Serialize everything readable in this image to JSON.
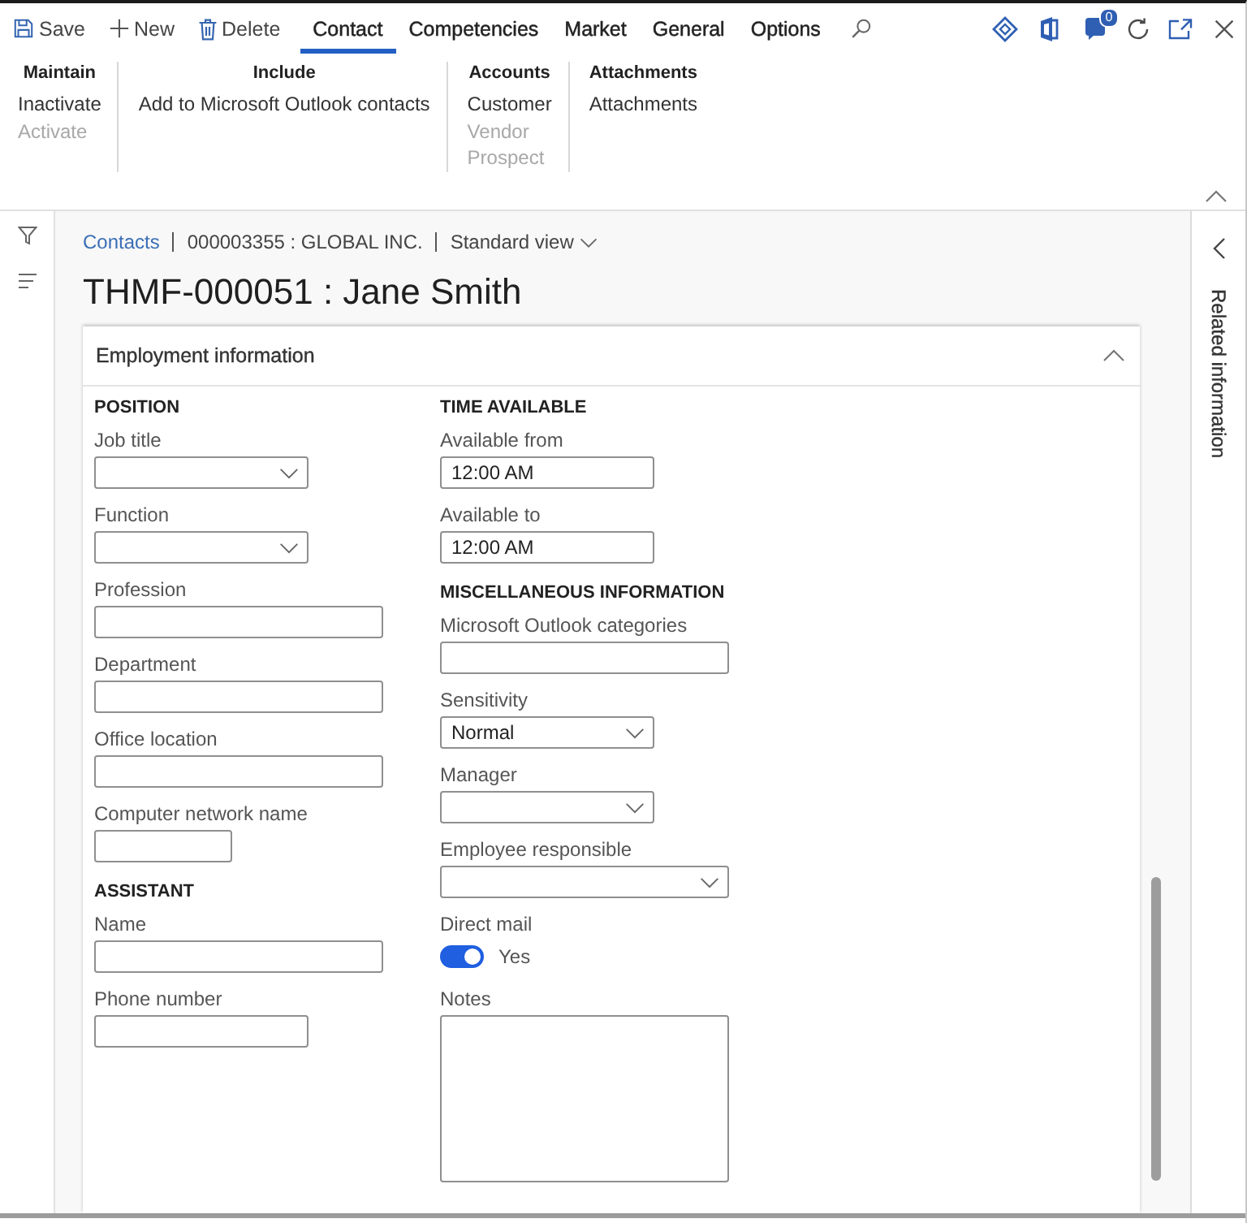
{
  "command_bar": {
    "save": {
      "label": "Save"
    },
    "new": {
      "label": "New"
    },
    "delete": {
      "label": "Delete"
    },
    "tabs": [
      {
        "label": "Contact",
        "selected": true
      },
      {
        "label": "Competencies",
        "selected": false
      },
      {
        "label": "Market",
        "selected": false
      },
      {
        "label": "General",
        "selected": false
      },
      {
        "label": "Options",
        "selected": false
      }
    ],
    "notification_count": "0"
  },
  "ribbon": {
    "groups": [
      {
        "title": "Maintain",
        "items": [
          {
            "label": "Inactivate",
            "disabled": false
          },
          {
            "label": "Activate",
            "disabled": true
          }
        ]
      },
      {
        "title": "Include",
        "items": [
          {
            "label": "Add to Microsoft Outlook contacts",
            "disabled": false
          }
        ]
      },
      {
        "title": "Accounts",
        "items": [
          {
            "label": "Customer",
            "disabled": false
          },
          {
            "label": "Vendor",
            "disabled": true
          },
          {
            "label": "Prospect",
            "disabled": true
          }
        ]
      },
      {
        "title": "Attachments",
        "items": [
          {
            "label": "Attachments",
            "disabled": false
          }
        ]
      }
    ]
  },
  "breadcrumb": {
    "link": "Contacts",
    "record": "000003355 : GLOBAL INC.",
    "view": "Standard view"
  },
  "title": "THMF-000051 : Jane Smith",
  "section": {
    "title": "Employment information",
    "expanded": true,
    "columns": [
      {
        "groups": [
          {
            "title": "POSITION",
            "fields": [
              {
                "label": "Job title",
                "kind": "dropdown"
              },
              {
                "label": "Function",
                "kind": "dropdown"
              },
              {
                "label": "Profession",
                "kind": "text"
              },
              {
                "label": "Department",
                "kind": "text"
              },
              {
                "label": "Office location",
                "kind": "text"
              },
              {
                "label": "Computer network name",
                "kind": "text"
              }
            ]
          },
          {
            "title": "ASSISTANT",
            "fields": [
              {
                "label": "Name",
                "kind": "text"
              },
              {
                "label": "Phone number",
                "kind": "text"
              }
            ]
          }
        ]
      },
      {
        "groups": [
          {
            "title": "TIME AVAILABLE",
            "fields": [
              {
                "label": "Available from",
                "kind": "text",
                "value": "12:00 AM"
              },
              {
                "label": "Available to",
                "kind": "text",
                "value": "12:00 AM"
              }
            ]
          },
          {
            "title": "MISCELLANEOUS INFORMATION",
            "fields": [
              {
                "label": "Microsoft Outlook categories",
                "kind": "text"
              },
              {
                "label": "Sensitivity",
                "kind": "dropdown",
                "value": "Normal"
              },
              {
                "label": "Manager",
                "kind": "dropdown"
              },
              {
                "label": "Employee responsible",
                "kind": "dropdown"
              },
              {
                "label": "Direct mail",
                "kind": "toggle",
                "on": true,
                "value": "Yes"
              },
              {
                "label": "Notes",
                "kind": "textarea"
              }
            ]
          }
        ]
      }
    ]
  },
  "related_pane": {
    "title": "Related information"
  }
}
